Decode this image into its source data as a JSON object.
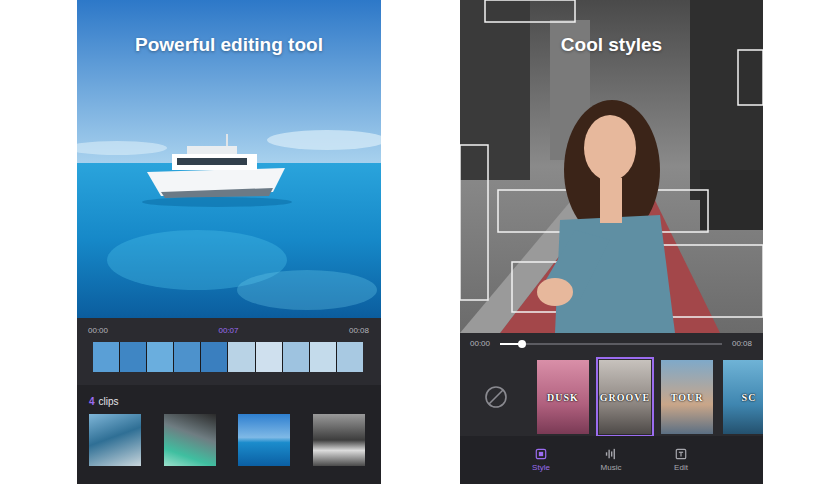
{
  "editor": {
    "headline": "Powerful editing tool",
    "timeline": {
      "start": "00:00",
      "current": "00:07",
      "end": "00:08"
    },
    "clips": {
      "count": "4",
      "label": "clips"
    }
  },
  "styles_screen": {
    "headline": "Cool styles",
    "progress": {
      "start": "00:00",
      "end": "00:08",
      "level": 0.1
    },
    "styles": [
      {
        "label": "DUSK",
        "selected": false
      },
      {
        "label": "GROOVE",
        "selected": true
      },
      {
        "label": "TOUR",
        "selected": false
      },
      {
        "label": "SC",
        "selected": false
      }
    ],
    "tabs": [
      {
        "label": "Style",
        "selected": true
      },
      {
        "label": "Music",
        "selected": false
      },
      {
        "label": "Edit",
        "selected": false
      }
    ]
  }
}
